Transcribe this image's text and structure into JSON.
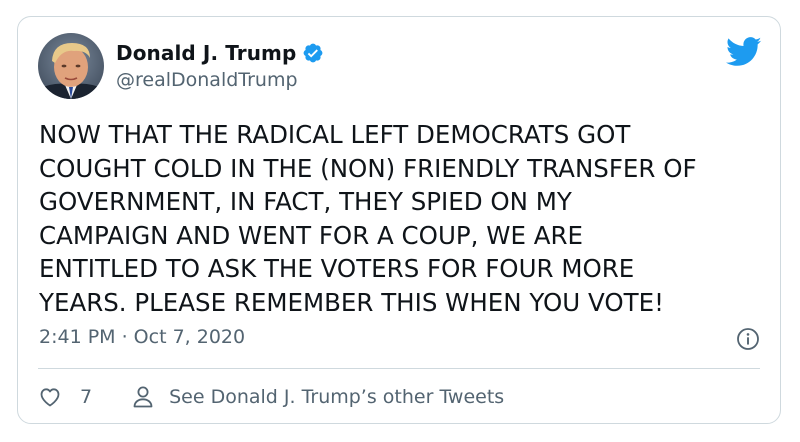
{
  "author": {
    "display_name": "Donald J. Trump",
    "handle": "@realDonaldTrump",
    "verified": true
  },
  "tweet": {
    "text": "NOW THAT THE RADICAL LEFT DEMOCRATS GOT\nCOUGHT COLD IN THE (NON) FRIENDLY TRANSFER OF\nGOVERNMENT, IN FACT, THEY SPIED ON MY\nCAMPAIGN AND WENT FOR A COUP, WE ARE\nENTITLED TO ASK THE VOTERS FOR FOUR MORE\nYEARS. PLEASE REMEMBER THIS WHEN YOU VOTE!",
    "timestamp": "2:41 PM · Oct 7, 2020"
  },
  "actions": {
    "like_count": "7",
    "profile_link_label": "See Donald J. Trump’s other Tweets"
  },
  "icons": {
    "brand": "twitter-bird-icon",
    "verified": "verified-badge-icon",
    "info": "info-icon",
    "like": "heart-icon",
    "profile": "person-icon"
  },
  "colors": {
    "brand_blue": "#1d9bf0",
    "text_primary": "#0f1419",
    "text_secondary": "#536471",
    "border": "#cfd9de"
  }
}
